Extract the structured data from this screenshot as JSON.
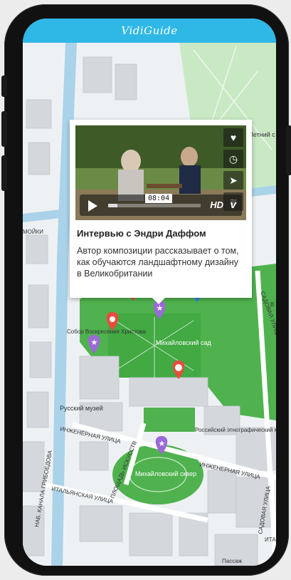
{
  "app": {
    "title": "VidiGuide",
    "accent_color": "#2fb8e6"
  },
  "popup": {
    "title": "Интервью с Эндри Даффом",
    "description": "Автор композиции рассказывает о том, как обучаются ландшафтному дизайну в Великобритании",
    "video": {
      "time": "08:04",
      "progress": 0.1,
      "quality_label": "HD",
      "provider_label": "v",
      "side_icons": [
        "heart-icon",
        "clock-icon",
        "send-icon",
        "layers-icon"
      ]
    }
  },
  "map": {
    "labels": {
      "letny": "Летний с",
      "sobor": "Собор Воскресения Христова",
      "mikh_sad": "Михайловский сад",
      "russian_museum": "Русский музей",
      "inzhenernaya1": "ИНЖЕНЕРНАЯ УЛИЦА",
      "inzhenernaya2": "ИНЖЕНЕРНАЯ УЛИЦА",
      "ethno_museum": "Российский этнографический музей",
      "ploshchad": "ПЛОЩАДЬ ИСКУССТВ",
      "mikh_skver": "Михайловский сквер",
      "italyanskaya": "ИТАЛЬЯНСКАЯ УЛИЦА",
      "kanal": "НАБ. КАНАЛА ГРИБОЕДОВА",
      "sadovaya1": "САДОВАЯ УЛИЦА",
      "sadovaya2": "САДОВАЯ УЛИЦА",
      "moiki": "МОЙКИ",
      "passazh": "Пассаж",
      "ita": "ИТА",
      "v": "В"
    },
    "pins": [
      {
        "name": "pin-red-top",
        "color": "#e74c3c",
        "icon": "exclamation"
      },
      {
        "name": "pin-red-tulip",
        "color": "#e74c3c",
        "icon": "tulip"
      },
      {
        "name": "pin-purple-sobor",
        "color": "#9b6ad6",
        "icon": "star"
      },
      {
        "name": "pin-purple-center",
        "color": "#9b6ad6",
        "icon": "star"
      },
      {
        "name": "pin-red-palette",
        "color": "#e74c3c",
        "icon": "palette"
      },
      {
        "name": "pin-purple-square",
        "color": "#9b6ad6",
        "icon": "star"
      },
      {
        "name": "pin-blue-top",
        "color": "#2e86de",
        "icon": "dot"
      }
    ]
  }
}
